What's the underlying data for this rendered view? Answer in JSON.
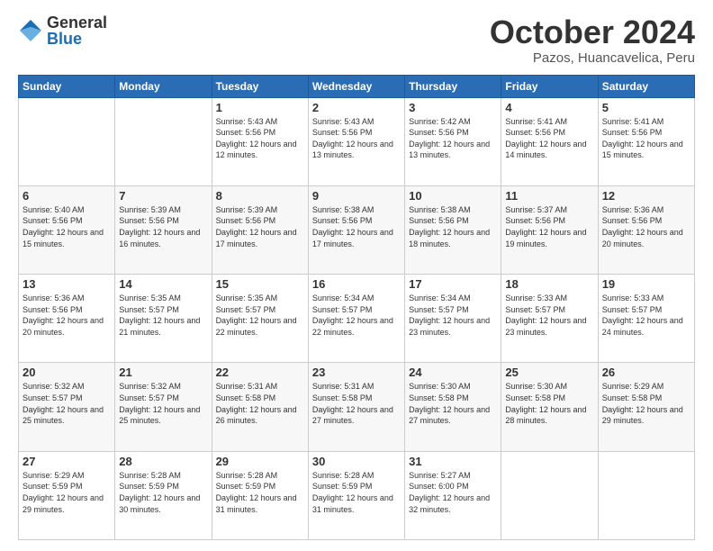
{
  "logo": {
    "general": "General",
    "blue": "Blue"
  },
  "header": {
    "title": "October 2024",
    "subtitle": "Pazos, Huancavelica, Peru"
  },
  "weekdays": [
    "Sunday",
    "Monday",
    "Tuesday",
    "Wednesday",
    "Thursday",
    "Friday",
    "Saturday"
  ],
  "weeks": [
    [
      {
        "day": "",
        "sunrise": "",
        "sunset": "",
        "daylight": ""
      },
      {
        "day": "",
        "sunrise": "",
        "sunset": "",
        "daylight": ""
      },
      {
        "day": "1",
        "sunrise": "Sunrise: 5:43 AM",
        "sunset": "Sunset: 5:56 PM",
        "daylight": "Daylight: 12 hours and 12 minutes."
      },
      {
        "day": "2",
        "sunrise": "Sunrise: 5:43 AM",
        "sunset": "Sunset: 5:56 PM",
        "daylight": "Daylight: 12 hours and 13 minutes."
      },
      {
        "day": "3",
        "sunrise": "Sunrise: 5:42 AM",
        "sunset": "Sunset: 5:56 PM",
        "daylight": "Daylight: 12 hours and 13 minutes."
      },
      {
        "day": "4",
        "sunrise": "Sunrise: 5:41 AM",
        "sunset": "Sunset: 5:56 PM",
        "daylight": "Daylight: 12 hours and 14 minutes."
      },
      {
        "day": "5",
        "sunrise": "Sunrise: 5:41 AM",
        "sunset": "Sunset: 5:56 PM",
        "daylight": "Daylight: 12 hours and 15 minutes."
      }
    ],
    [
      {
        "day": "6",
        "sunrise": "Sunrise: 5:40 AM",
        "sunset": "Sunset: 5:56 PM",
        "daylight": "Daylight: 12 hours and 15 minutes."
      },
      {
        "day": "7",
        "sunrise": "Sunrise: 5:39 AM",
        "sunset": "Sunset: 5:56 PM",
        "daylight": "Daylight: 12 hours and 16 minutes."
      },
      {
        "day": "8",
        "sunrise": "Sunrise: 5:39 AM",
        "sunset": "Sunset: 5:56 PM",
        "daylight": "Daylight: 12 hours and 17 minutes."
      },
      {
        "day": "9",
        "sunrise": "Sunrise: 5:38 AM",
        "sunset": "Sunset: 5:56 PM",
        "daylight": "Daylight: 12 hours and 17 minutes."
      },
      {
        "day": "10",
        "sunrise": "Sunrise: 5:38 AM",
        "sunset": "Sunset: 5:56 PM",
        "daylight": "Daylight: 12 hours and 18 minutes."
      },
      {
        "day": "11",
        "sunrise": "Sunrise: 5:37 AM",
        "sunset": "Sunset: 5:56 PM",
        "daylight": "Daylight: 12 hours and 19 minutes."
      },
      {
        "day": "12",
        "sunrise": "Sunrise: 5:36 AM",
        "sunset": "Sunset: 5:56 PM",
        "daylight": "Daylight: 12 hours and 20 minutes."
      }
    ],
    [
      {
        "day": "13",
        "sunrise": "Sunrise: 5:36 AM",
        "sunset": "Sunset: 5:56 PM",
        "daylight": "Daylight: 12 hours and 20 minutes."
      },
      {
        "day": "14",
        "sunrise": "Sunrise: 5:35 AM",
        "sunset": "Sunset: 5:57 PM",
        "daylight": "Daylight: 12 hours and 21 minutes."
      },
      {
        "day": "15",
        "sunrise": "Sunrise: 5:35 AM",
        "sunset": "Sunset: 5:57 PM",
        "daylight": "Daylight: 12 hours and 22 minutes."
      },
      {
        "day": "16",
        "sunrise": "Sunrise: 5:34 AM",
        "sunset": "Sunset: 5:57 PM",
        "daylight": "Daylight: 12 hours and 22 minutes."
      },
      {
        "day": "17",
        "sunrise": "Sunrise: 5:34 AM",
        "sunset": "Sunset: 5:57 PM",
        "daylight": "Daylight: 12 hours and 23 minutes."
      },
      {
        "day": "18",
        "sunrise": "Sunrise: 5:33 AM",
        "sunset": "Sunset: 5:57 PM",
        "daylight": "Daylight: 12 hours and 23 minutes."
      },
      {
        "day": "19",
        "sunrise": "Sunrise: 5:33 AM",
        "sunset": "Sunset: 5:57 PM",
        "daylight": "Daylight: 12 hours and 24 minutes."
      }
    ],
    [
      {
        "day": "20",
        "sunrise": "Sunrise: 5:32 AM",
        "sunset": "Sunset: 5:57 PM",
        "daylight": "Daylight: 12 hours and 25 minutes."
      },
      {
        "day": "21",
        "sunrise": "Sunrise: 5:32 AM",
        "sunset": "Sunset: 5:57 PM",
        "daylight": "Daylight: 12 hours and 25 minutes."
      },
      {
        "day": "22",
        "sunrise": "Sunrise: 5:31 AM",
        "sunset": "Sunset: 5:58 PM",
        "daylight": "Daylight: 12 hours and 26 minutes."
      },
      {
        "day": "23",
        "sunrise": "Sunrise: 5:31 AM",
        "sunset": "Sunset: 5:58 PM",
        "daylight": "Daylight: 12 hours and 27 minutes."
      },
      {
        "day": "24",
        "sunrise": "Sunrise: 5:30 AM",
        "sunset": "Sunset: 5:58 PM",
        "daylight": "Daylight: 12 hours and 27 minutes."
      },
      {
        "day": "25",
        "sunrise": "Sunrise: 5:30 AM",
        "sunset": "Sunset: 5:58 PM",
        "daylight": "Daylight: 12 hours and 28 minutes."
      },
      {
        "day": "26",
        "sunrise": "Sunrise: 5:29 AM",
        "sunset": "Sunset: 5:58 PM",
        "daylight": "Daylight: 12 hours and 29 minutes."
      }
    ],
    [
      {
        "day": "27",
        "sunrise": "Sunrise: 5:29 AM",
        "sunset": "Sunset: 5:59 PM",
        "daylight": "Daylight: 12 hours and 29 minutes."
      },
      {
        "day": "28",
        "sunrise": "Sunrise: 5:28 AM",
        "sunset": "Sunset: 5:59 PM",
        "daylight": "Daylight: 12 hours and 30 minutes."
      },
      {
        "day": "29",
        "sunrise": "Sunrise: 5:28 AM",
        "sunset": "Sunset: 5:59 PM",
        "daylight": "Daylight: 12 hours and 31 minutes."
      },
      {
        "day": "30",
        "sunrise": "Sunrise: 5:28 AM",
        "sunset": "Sunset: 5:59 PM",
        "daylight": "Daylight: 12 hours and 31 minutes."
      },
      {
        "day": "31",
        "sunrise": "Sunrise: 5:27 AM",
        "sunset": "Sunset: 6:00 PM",
        "daylight": "Daylight: 12 hours and 32 minutes."
      },
      {
        "day": "",
        "sunrise": "",
        "sunset": "",
        "daylight": ""
      },
      {
        "day": "",
        "sunrise": "",
        "sunset": "",
        "daylight": ""
      }
    ]
  ]
}
